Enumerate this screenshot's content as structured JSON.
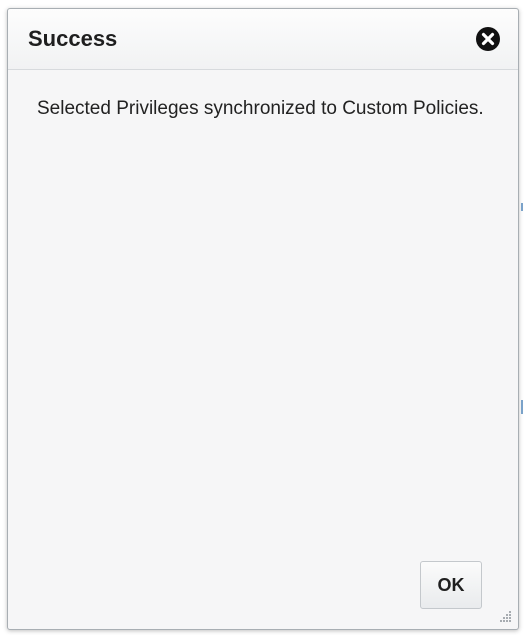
{
  "dialog": {
    "title": "Success",
    "message": "Selected Privileges synchronized to Custom Policies.",
    "ok_label": "OK"
  },
  "icons": {
    "close": "close-circle-icon",
    "resize": "resize-grip-icon"
  },
  "colors": {
    "dialog_background": "#f6f6f7",
    "header_background": "#f1f2f3",
    "text": "#1f1f1f",
    "close_icon": "#111111"
  }
}
